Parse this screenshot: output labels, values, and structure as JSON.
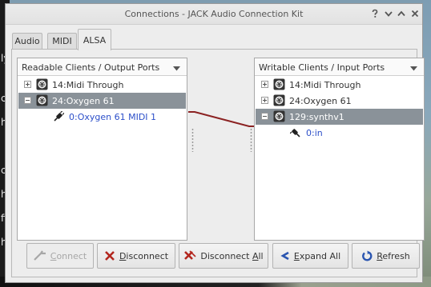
{
  "window": {
    "title": "Connections - JACK Audio Connection Kit",
    "controls": [
      "help-icon",
      "minimize-icon",
      "maximize-icon",
      "close-icon"
    ]
  },
  "tabs": [
    {
      "label": "Audio",
      "active": false
    },
    {
      "label": "MIDI",
      "active": false
    },
    {
      "label": "ALSA",
      "active": true
    }
  ],
  "readable": {
    "header": "Readable Clients / Output Ports",
    "items": [
      {
        "label": "14:Midi Through",
        "expander": "+",
        "selected": false
      },
      {
        "label": "24:Oxygen 61",
        "expander": "-",
        "selected": true
      },
      {
        "label": "0:Oxygen 61 MIDI 1",
        "type": "port",
        "selected": false
      }
    ]
  },
  "writable": {
    "header": "Writable Clients / Input Ports",
    "items": [
      {
        "label": "14:Midi Through",
        "expander": "+",
        "selected": false
      },
      {
        "label": "24:Oxygen 61",
        "expander": "+",
        "selected": false
      },
      {
        "label": "129:synthv1",
        "expander": "-",
        "selected": true
      },
      {
        "label": "0:in",
        "type": "port",
        "selected": false
      }
    ]
  },
  "connection_line_color": "#8b2222",
  "buttons": {
    "connect": {
      "pre": "",
      "mnemonic": "C",
      "post": "onnect",
      "enabled": false
    },
    "disconnect": {
      "pre": "",
      "mnemonic": "D",
      "post": "isconnect",
      "enabled": true
    },
    "disconnect_all": {
      "pre": "Disconnect ",
      "mnemonic": "A",
      "post": "ll",
      "enabled": true
    },
    "expand_all": {
      "pre": "",
      "mnemonic": "E",
      "post": "xpand All",
      "enabled": true
    },
    "refresh": {
      "pre": "",
      "mnemonic": "R",
      "post": "efresh",
      "enabled": true
    }
  },
  "background_text": [
    "ly",
    "ci",
    "h",
    "ci",
    "h",
    "fi",
    "h"
  ]
}
